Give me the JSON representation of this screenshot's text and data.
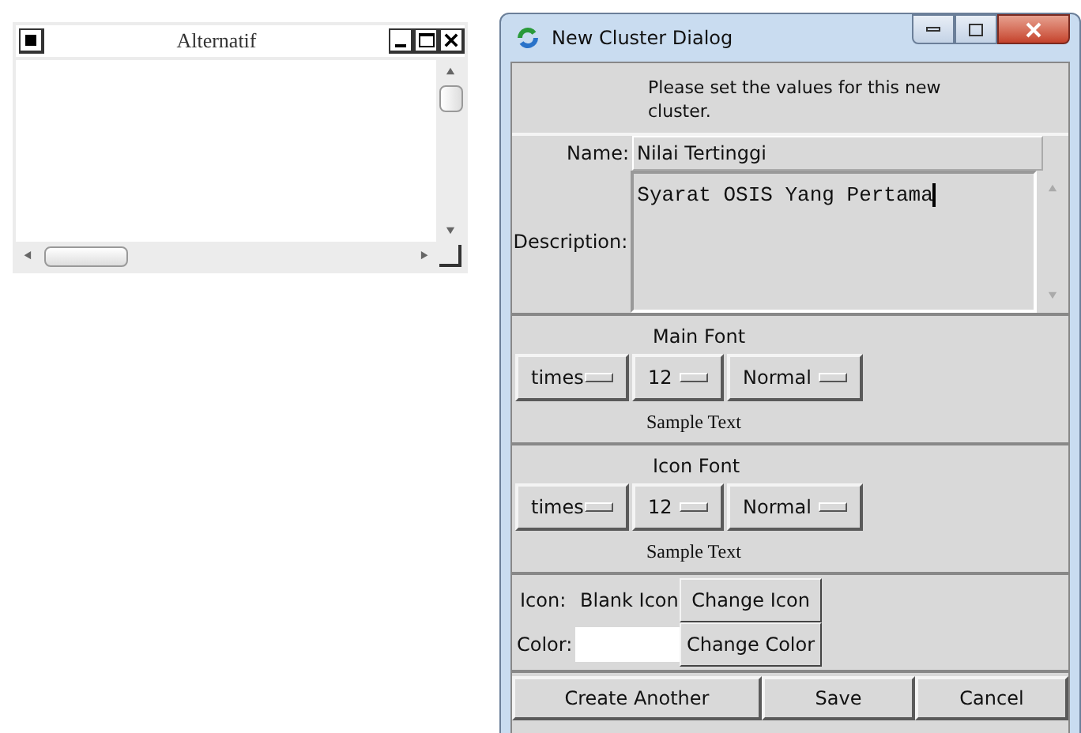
{
  "list_window": {
    "title": "Alternatif"
  },
  "dialog": {
    "title": "New Cluster Dialog",
    "message": "Please set the values for this new cluster.",
    "name_label": "Name:",
    "name_value": "Nilai Tertinggi",
    "description_label": "Description:",
    "description_value": "Syarat OSIS Yang Pertama",
    "font_sections": [
      {
        "title": "Main Font",
        "family": "times",
        "size": "12",
        "style": "Normal",
        "sample": "Sample Text"
      },
      {
        "title": "Icon Font",
        "family": "times",
        "size": "12",
        "style": "Normal",
        "sample": "Sample Text"
      }
    ],
    "icon_label": "Icon:",
    "icon_value": "Blank Icon",
    "change_icon": "Change Icon",
    "color_label": "Color:",
    "color": "#ffffff",
    "change_color": "Change Color",
    "buttons": [
      "Create Another",
      "Save",
      "Cancel"
    ]
  }
}
